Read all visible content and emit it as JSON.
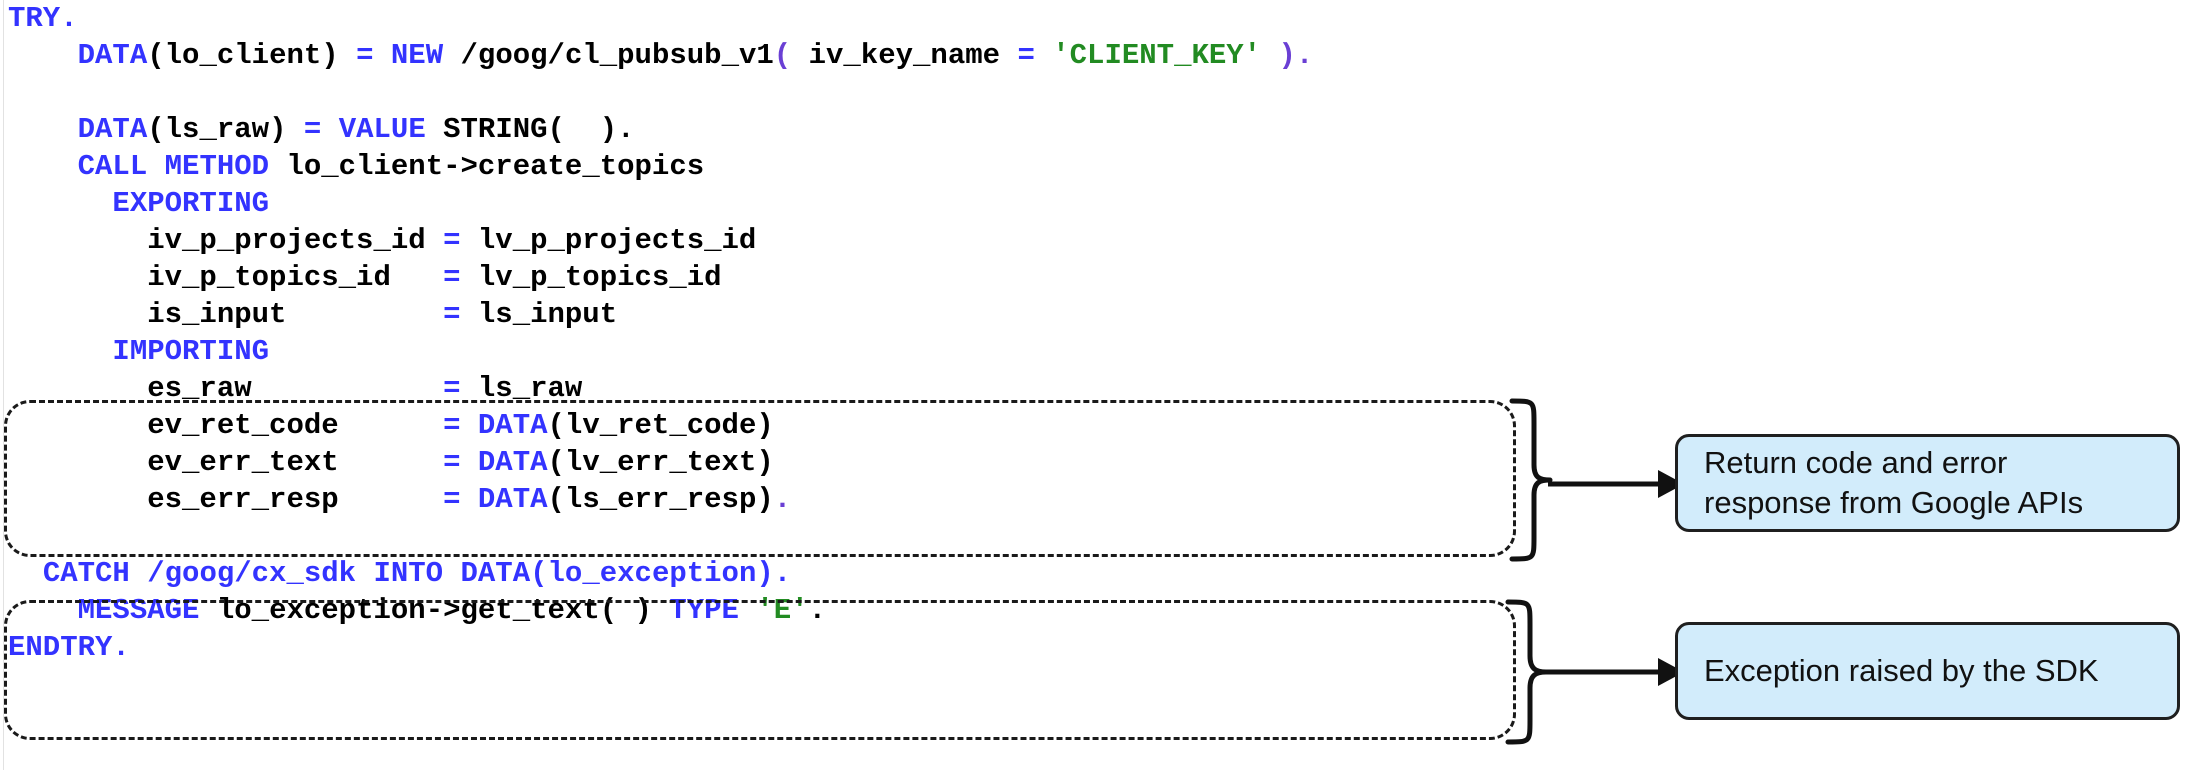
{
  "document": {
    "kind": "abap-code-annotated-diagram",
    "language": "ABAP"
  },
  "code": {
    "lines": [
      [
        {
          "t": "TRY.",
          "c": "kw"
        }
      ],
      [
        {
          "t": "    ",
          "c": "pln"
        },
        {
          "t": "DATA",
          "c": "kw"
        },
        {
          "t": "(lo_client) ",
          "c": "pln"
        },
        {
          "t": "= ",
          "c": "kw"
        },
        {
          "t": "NEW",
          "c": "kw"
        },
        {
          "t": " /goog/cl_pubsub_v1",
          "c": "pln"
        },
        {
          "t": "(",
          "c": "pct"
        },
        {
          "t": " iv_key_name ",
          "c": "pln"
        },
        {
          "t": "= ",
          "c": "kw"
        },
        {
          "t": "'CLIENT_KEY'",
          "c": "str"
        },
        {
          "t": " )",
          "c": "pct"
        },
        {
          "t": ".",
          "c": "pct"
        }
      ],
      [
        {
          "t": " ",
          "c": "pln"
        }
      ],
      [
        {
          "t": "    ",
          "c": "pln"
        },
        {
          "t": "DATA",
          "c": "kw"
        },
        {
          "t": "(ls_raw) ",
          "c": "pln"
        },
        {
          "t": "= ",
          "c": "kw"
        },
        {
          "t": "VALUE",
          "c": "kw"
        },
        {
          "t": " STRING(  ).",
          "c": "pln"
        }
      ],
      [
        {
          "t": "    ",
          "c": "pln"
        },
        {
          "t": "CALL METHOD",
          "c": "kw"
        },
        {
          "t": " lo_client->create_topics",
          "c": "pln"
        }
      ],
      [
        {
          "t": "      ",
          "c": "pln"
        },
        {
          "t": "EXPORTING",
          "c": "kw"
        }
      ],
      [
        {
          "t": "        iv_p_projects_id ",
          "c": "pln"
        },
        {
          "t": "= ",
          "c": "kw"
        },
        {
          "t": "lv_p_projects_id",
          "c": "pln"
        }
      ],
      [
        {
          "t": "        iv_p_topics_id   ",
          "c": "pln"
        },
        {
          "t": "= ",
          "c": "kw"
        },
        {
          "t": "lv_p_topics_id",
          "c": "pln"
        }
      ],
      [
        {
          "t": "        is_input         ",
          "c": "pln"
        },
        {
          "t": "= ",
          "c": "kw"
        },
        {
          "t": "ls_input",
          "c": "pln"
        }
      ],
      [
        {
          "t": "      ",
          "c": "pln"
        },
        {
          "t": "IMPORTING",
          "c": "kw"
        }
      ],
      [
        {
          "t": "        es_raw           ",
          "c": "pln"
        },
        {
          "t": "= ",
          "c": "kw"
        },
        {
          "t": "ls_raw",
          "c": "pln"
        }
      ],
      [
        {
          "t": "        ev_ret_code      ",
          "c": "pln"
        },
        {
          "t": "= ",
          "c": "kw"
        },
        {
          "t": "DATA",
          "c": "kw"
        },
        {
          "t": "(lv_ret_code)",
          "c": "pln"
        }
      ],
      [
        {
          "t": "        ev_err_text      ",
          "c": "pln"
        },
        {
          "t": "= ",
          "c": "kw"
        },
        {
          "t": "DATA",
          "c": "kw"
        },
        {
          "t": "(lv_err_text)",
          "c": "pln"
        }
      ],
      [
        {
          "t": "        es_err_resp      ",
          "c": "pln"
        },
        {
          "t": "= ",
          "c": "kw"
        },
        {
          "t": "DATA",
          "c": "kw"
        },
        {
          "t": "(ls_err_resp)",
          "c": "pln"
        },
        {
          "t": ".",
          "c": "pct"
        }
      ],
      [
        {
          "t": " ",
          "c": "pln"
        }
      ],
      [
        {
          "t": "  ",
          "c": "pln"
        },
        {
          "t": "CATCH",
          "c": "kw"
        },
        {
          "t": " /goog/cx_sdk ",
          "c": "kw"
        },
        {
          "t": "INTO",
          "c": "kw"
        },
        {
          "t": " ",
          "c": "pln"
        },
        {
          "t": "DATA",
          "c": "kw"
        },
        {
          "t": "(lo_exception).",
          "c": "kw"
        }
      ],
      [
        {
          "t": "    ",
          "c": "pln"
        },
        {
          "t": "MESSAGE",
          "c": "kw"
        },
        {
          "t": " lo_exception->get_text( ) ",
          "c": "pln"
        },
        {
          "t": "TYPE",
          "c": "kw"
        },
        {
          "t": " ",
          "c": "pln"
        },
        {
          "t": "'E'",
          "c": "str"
        },
        {
          "t": ".",
          "c": "pln"
        }
      ],
      [
        {
          "t": "ENDTRY.",
          "c": "kw"
        }
      ]
    ],
    "plain_text": "TRY.\n    DATA(lo_client) = NEW /goog/cl_pubsub_v1( iv_key_name = 'CLIENT_KEY' ).\n\n    DATA(ls_raw) = VALUE STRING(  ).\n    CALL METHOD lo_client->create_topics\n      EXPORTING\n        iv_p_projects_id = lv_p_projects_id\n        iv_p_topics_id   = lv_p_topics_id\n        is_input         = ls_input\n      IMPORTING\n        es_raw           = ls_raw\n        ev_ret_code      = DATA(lv_ret_code)\n        ev_err_text      = DATA(lv_err_text)\n        es_err_resp      = DATA(ls_err_resp).\n\n  CATCH /goog/cx_sdk INTO DATA(lo_exception).\n    MESSAGE lo_exception->get_text( ) TYPE 'E'.\nENDTRY."
  },
  "annotations": [
    {
      "id": "return-code",
      "label": "Return code and error\nresponse from Google APIs",
      "targets_lines": [
        "es_raw",
        "ev_ret_code",
        "ev_err_text",
        "es_err_resp"
      ]
    },
    {
      "id": "exception",
      "label": "Exception raised by the SDK",
      "targets_lines": [
        "CATCH /goog/cx_sdk INTO DATA(lo_exception).",
        "MESSAGE lo_exception->get_text( ) TYPE 'E'.",
        "ENDTRY."
      ]
    }
  ],
  "colors": {
    "keyword": "#3333ff",
    "string": "#228b22",
    "identifier": "#000000",
    "punctuation": "#6a3fd4",
    "callout_fill": "#d2ecfb",
    "callout_border": "#1f1f1f",
    "dashed_border": "#1a1a1a",
    "page_background": "#ffffff"
  }
}
